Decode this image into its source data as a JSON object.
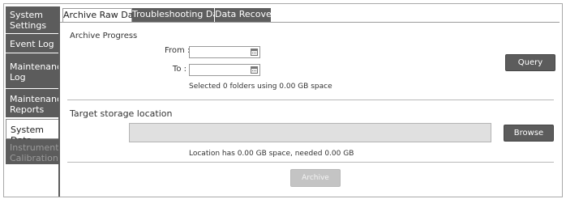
{
  "nav": {
    "items": [
      {
        "label": "System Settings",
        "state": "normal"
      },
      {
        "label": "Event Log",
        "state": "normal"
      },
      {
        "label": "Maintenance Log",
        "state": "normal"
      },
      {
        "label": "Maintenance Reports",
        "state": "normal"
      },
      {
        "label": "System Data",
        "state": "selected"
      },
      {
        "label": "Instrument Calibration",
        "state": "disabled"
      }
    ]
  },
  "tabs": [
    {
      "label": "Archive Raw Data",
      "selected": true
    },
    {
      "label": "Troubleshooting Data",
      "selected": false
    },
    {
      "label": "Data Recovery",
      "selected": false
    }
  ],
  "archive": {
    "section_title": "Archive Progress",
    "from_label": "From :",
    "from_value": "",
    "to_label": "To :",
    "to_value": "",
    "selection_status": "Selected 0 folders using 0.00 GB space",
    "query_button": "Query"
  },
  "storage": {
    "section_title": "Target storage location",
    "path_value": "",
    "browse_button": "Browse",
    "space_status": "Location has 0.00 GB space, needed 0.00 GB"
  },
  "archive_button": "Archive",
  "colors": {
    "nav_bg": "#5c5c5c",
    "button_bg": "#5c5c5c",
    "disabled_button_bg": "#c4c4c4"
  }
}
